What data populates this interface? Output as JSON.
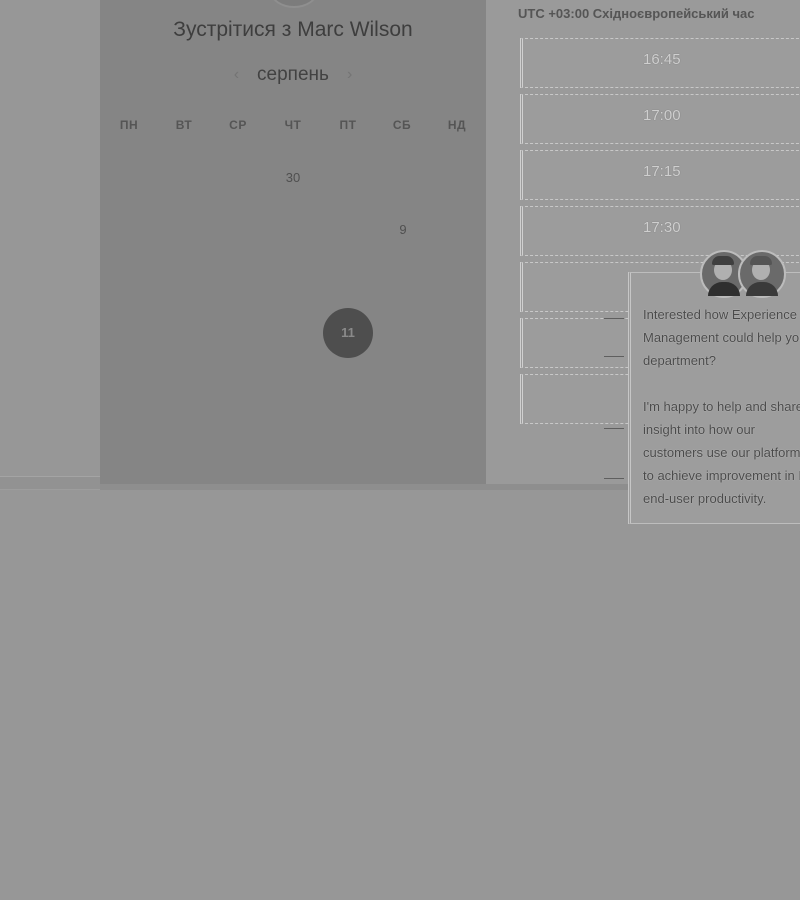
{
  "calendar": {
    "title": "Зустрітися з Marc Wilson",
    "month": "серпень",
    "prev_icon": "‹",
    "next_icon": "›",
    "weekdays": [
      "ПН",
      "ВТ",
      "СР",
      "ЧТ",
      "ПТ",
      "СБ",
      "НД"
    ],
    "visible_days": [
      "30",
      "9"
    ],
    "selected_day": "11"
  },
  "times": {
    "timezone": "UTC +03:00 Східноєвропейський час",
    "slots": [
      "16:45",
      "17:00",
      "17:15",
      "17:30"
    ]
  },
  "chat": {
    "paragraph1": "Interested how Experience Management could help your department?",
    "paragraph2": "I'm happy to help and share insight into how our customers use our platform to achieve improvement in IT end-user productivity."
  }
}
